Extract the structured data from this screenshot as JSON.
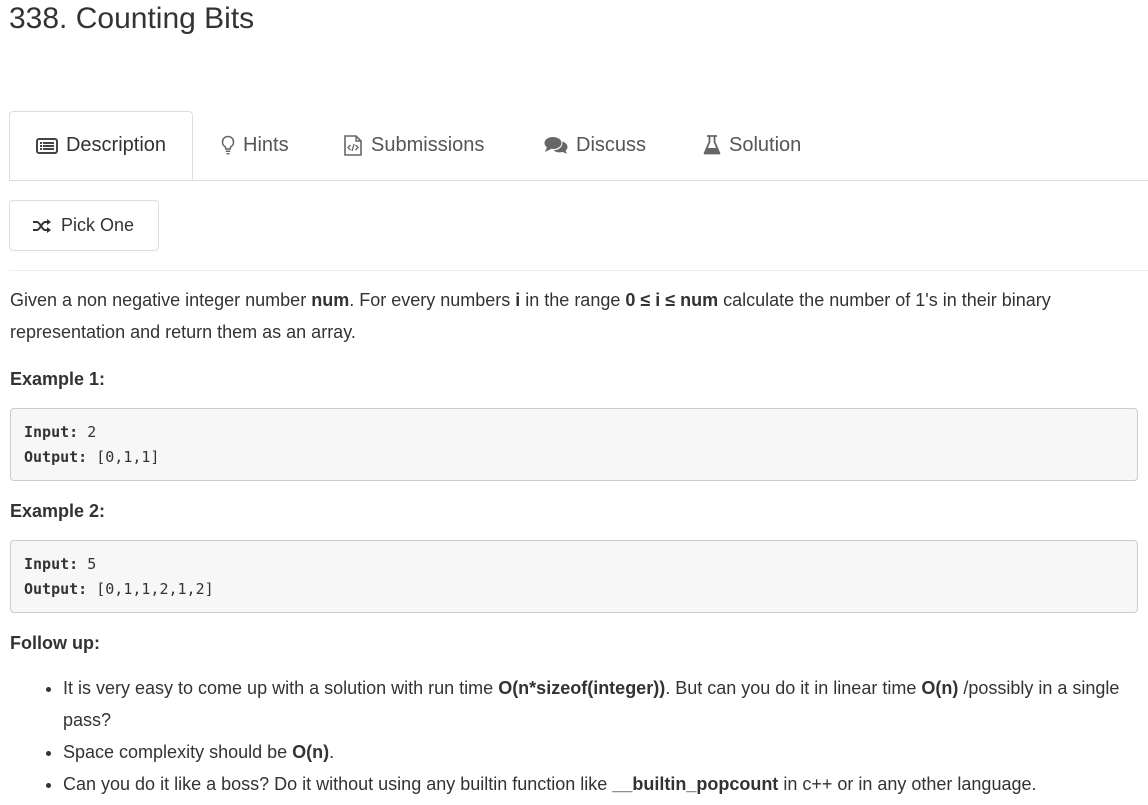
{
  "page_title": "338. Counting Bits",
  "tabs": [
    {
      "label": "Description",
      "icon": "list-icon",
      "active": true
    },
    {
      "label": "Hints",
      "icon": "lightbulb-icon",
      "active": false
    },
    {
      "label": "Submissions",
      "icon": "code-file-icon",
      "active": false
    },
    {
      "label": "Discuss",
      "icon": "comments-icon",
      "active": false
    },
    {
      "label": "Solution",
      "icon": "flask-icon",
      "active": false
    }
  ],
  "pick_one": {
    "label": "Pick One",
    "icon": "shuffle-icon"
  },
  "description": {
    "t1": "Given a non negative integer number ",
    "num1": "num",
    "t2": ". For every numbers ",
    "i": "i",
    "t3": " in the range ",
    "range": "0 ≤ i ≤ num",
    "t4": " calculate the number of 1's in their binary representation and return them as an array."
  },
  "example1": {
    "heading": "Example 1:",
    "input_label": "Input:",
    "input_value": "2",
    "output_label": "Output:",
    "output_value": "[0,1,1]"
  },
  "example2": {
    "heading": "Example 2:",
    "input_label": "Input:",
    "input_value": "5",
    "output_label": "Output:",
    "output_value": "[0,1,1,2,1,2]"
  },
  "follow_up": {
    "heading": "Follow up:",
    "item1": {
      "t1": "It is very easy to come up with a solution with run time ",
      "b1": "O(n*sizeof(integer))",
      "t2": ". But can you do it in linear time ",
      "b2": "O(n)",
      "t3": " /possibly in a single pass?"
    },
    "item2": {
      "t1": "Space complexity should be ",
      "b1": "O(n)",
      "t2": "."
    },
    "item3": {
      "t1": "Can you do it like a boss? Do it without using any builtin function like ",
      "b1": "__builtin_popcount",
      "t2": " in c++ or in any other language."
    }
  },
  "colors": {
    "text": "#333333",
    "muted": "#555555",
    "border": "#dddddd",
    "code_bg": "#f7f7f7"
  }
}
